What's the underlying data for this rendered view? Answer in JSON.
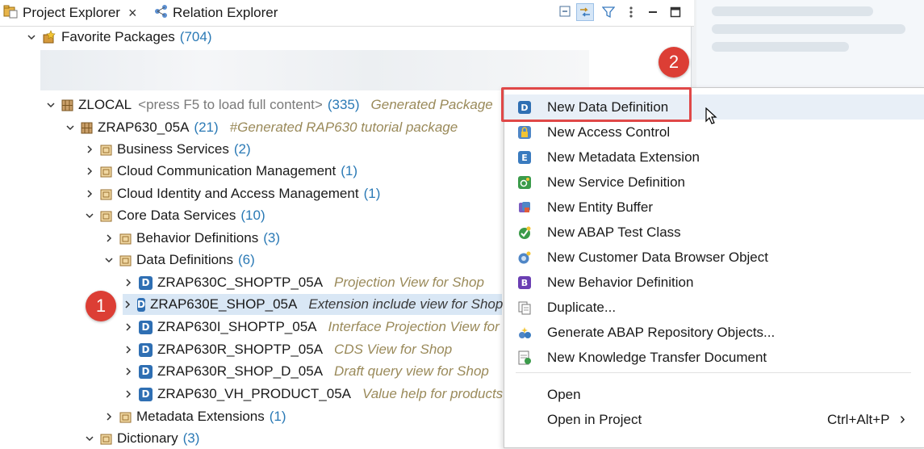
{
  "tabs": {
    "project_explorer": "Project Explorer",
    "relation_explorer": "Relation Explorer",
    "close_glyph": "×"
  },
  "tree": {
    "favorites": {
      "label": "Favorite Packages",
      "count": "(704)"
    },
    "zlocal": {
      "label": "ZLOCAL",
      "hint": "<press F5 to load full content>",
      "count": "(335)",
      "desc": "Generated Package"
    },
    "zrap": {
      "label": "ZRAP630_05A",
      "count": "(21)",
      "desc": "#Generated RAP630  tutorial package"
    },
    "business_services": {
      "label": "Business Services",
      "count": "(2)"
    },
    "cloud_comm": {
      "label": "Cloud Communication Management",
      "count": "(1)"
    },
    "cloud_identity": {
      "label": "Cloud Identity and Access Management",
      "count": "(1)"
    },
    "core_ds": {
      "label": "Core Data Services",
      "count": "(10)"
    },
    "behavior_defs": {
      "label": "Behavior Definitions",
      "count": "(3)"
    },
    "data_defs": {
      "label": "Data Definitions",
      "count": "(6)"
    },
    "dd_items": [
      {
        "label": "ZRAP630C_SHOPTP_05A",
        "desc": "Projection View for Shop"
      },
      {
        "label": "ZRAP630E_SHOP_05A",
        "desc": "Extension include view for Shop"
      },
      {
        "label": "ZRAP630I_SHOPTP_05A",
        "desc": "Interface Projection View for S"
      },
      {
        "label": "ZRAP630R_SHOPTP_05A",
        "desc": "CDS View for Shop"
      },
      {
        "label": "ZRAP630R_SHOP_D_05A",
        "desc": "Draft query view for Shop"
      },
      {
        "label": "ZRAP630_VH_PRODUCT_05A",
        "desc": "Value help for products"
      }
    ],
    "metadata_ext": {
      "label": "Metadata Extensions",
      "count": "(1)"
    },
    "dictionary": {
      "label": "Dictionary",
      "count": "(3)"
    },
    "d_glyph": "D"
  },
  "menu": {
    "items": [
      {
        "label": "New Data Definition",
        "icon": "data-definition-icon"
      },
      {
        "label": "New Access Control",
        "icon": "access-control-icon"
      },
      {
        "label": "New Metadata Extension",
        "icon": "metadata-extension-icon"
      },
      {
        "label": "New Service Definition",
        "icon": "service-definition-icon"
      },
      {
        "label": "New Entity Buffer",
        "icon": "entity-buffer-icon"
      },
      {
        "label": "New ABAP Test Class",
        "icon": "test-class-icon"
      },
      {
        "label": "New Customer Data Browser Object",
        "icon": "data-browser-icon"
      },
      {
        "label": "New Behavior Definition",
        "icon": "behavior-definition-icon"
      },
      {
        "label": "Duplicate...",
        "icon": "duplicate-icon"
      },
      {
        "label": "Generate ABAP Repository Objects...",
        "icon": "generate-icon"
      },
      {
        "label": "New Knowledge Transfer Document",
        "icon": "knowledge-transfer-icon"
      }
    ],
    "open": "Open",
    "open_in_project": "Open in Project",
    "open_in_project_shortcut": "Ctrl+Alt+P",
    "submenu_arrow": "›"
  },
  "badges": {
    "step1": "1",
    "step2": "2"
  },
  "colors": {
    "badge": "#dc3e35",
    "highlight": "#e04848",
    "count": "#2a79b5",
    "selection": "#d9e7f5"
  }
}
